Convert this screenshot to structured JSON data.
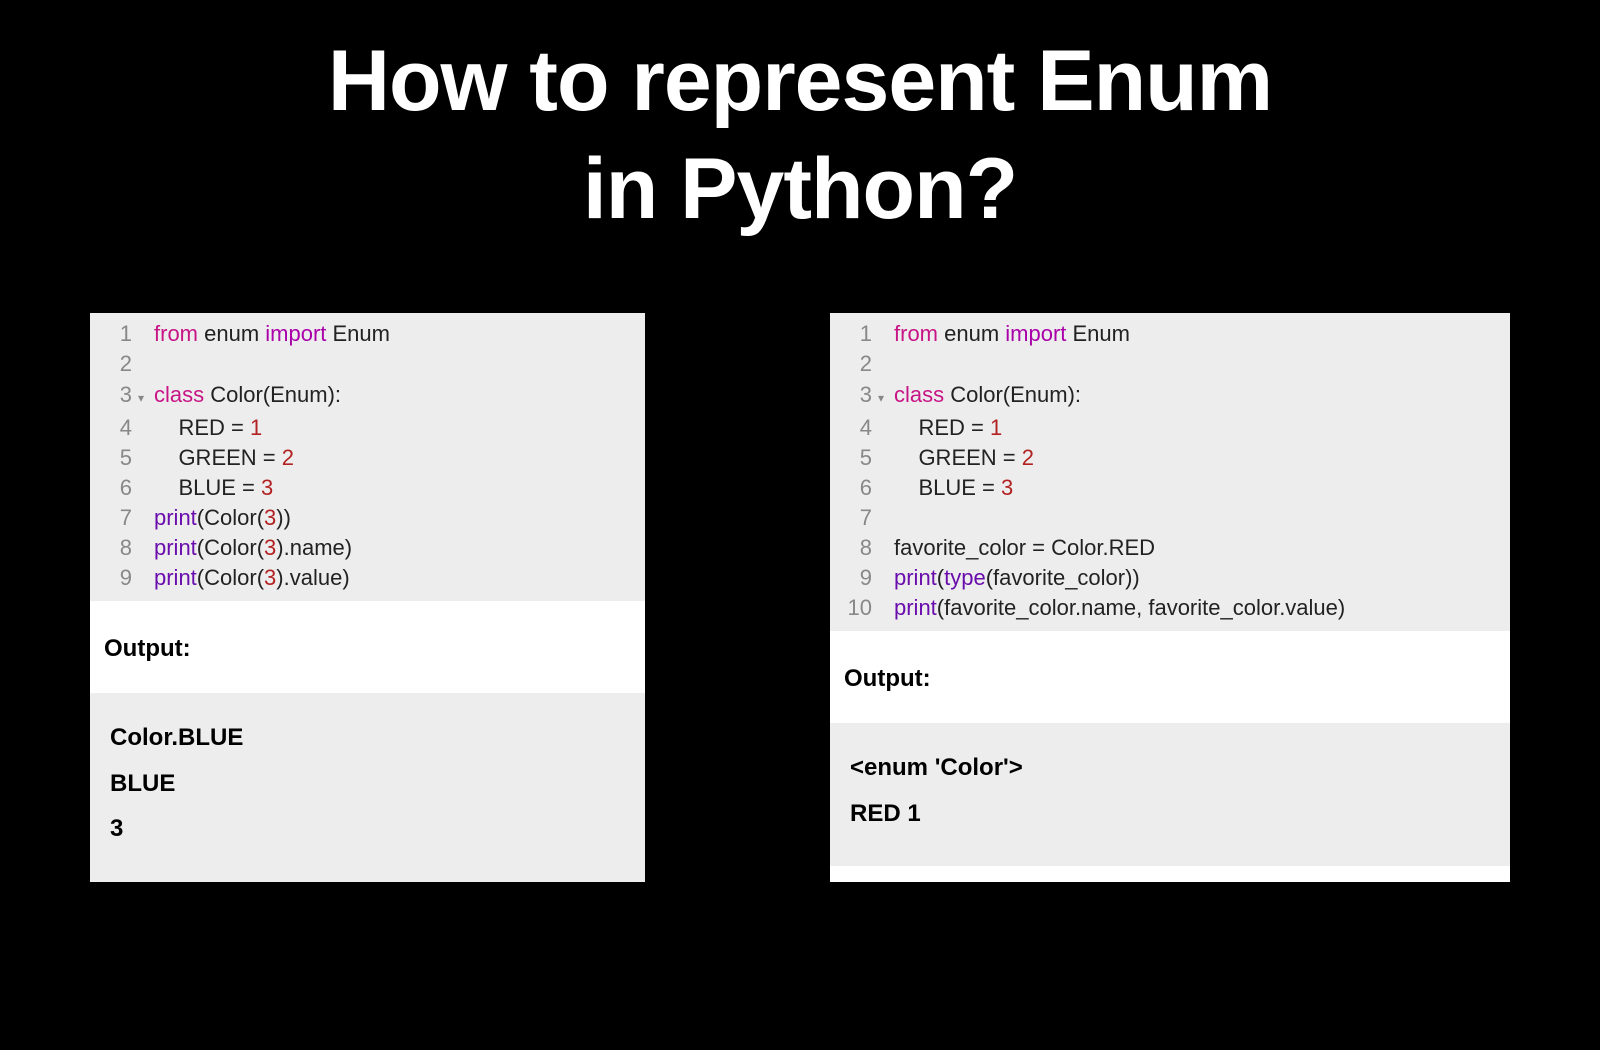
{
  "title_line1": "How to represent Enum",
  "title_line2": "in Python?",
  "left": {
    "lines": [
      {
        "n": "1",
        "fold": "",
        "segments": [
          {
            "t": "from",
            "c": "kw"
          },
          {
            "t": " enum ",
            "c": "txt"
          },
          {
            "t": "import",
            "c": "kw2"
          },
          {
            "t": " Enum",
            "c": "txt"
          }
        ]
      },
      {
        "n": "2",
        "fold": "",
        "segments": []
      },
      {
        "n": "3",
        "fold": "▾",
        "segments": [
          {
            "t": "class",
            "c": "kw"
          },
          {
            "t": " Color(Enum):",
            "c": "txt"
          }
        ]
      },
      {
        "n": "4",
        "fold": "",
        "segments": [
          {
            "t": "    RED = ",
            "c": "txt"
          },
          {
            "t": "1",
            "c": "num"
          }
        ]
      },
      {
        "n": "5",
        "fold": "",
        "segments": [
          {
            "t": "    GREEN = ",
            "c": "txt"
          },
          {
            "t": "2",
            "c": "num"
          }
        ]
      },
      {
        "n": "6",
        "fold": "",
        "segments": [
          {
            "t": "    BLUE = ",
            "c": "txt"
          },
          {
            "t": "3",
            "c": "num"
          }
        ]
      },
      {
        "n": "7",
        "fold": "",
        "segments": [
          {
            "t": "print",
            "c": "fn"
          },
          {
            "t": "(Color(",
            "c": "txt"
          },
          {
            "t": "3",
            "c": "num"
          },
          {
            "t": "))",
            "c": "txt"
          }
        ]
      },
      {
        "n": "8",
        "fold": "",
        "segments": [
          {
            "t": "print",
            "c": "fn"
          },
          {
            "t": "(Color(",
            "c": "txt"
          },
          {
            "t": "3",
            "c": "num"
          },
          {
            "t": ").name)",
            "c": "txt"
          }
        ]
      },
      {
        "n": "9",
        "fold": "",
        "segments": [
          {
            "t": "print",
            "c": "fn"
          },
          {
            "t": "(Color(",
            "c": "txt"
          },
          {
            "t": "3",
            "c": "num"
          },
          {
            "t": ").value)",
            "c": "txt"
          }
        ]
      }
    ],
    "output_label": "Output:",
    "output": [
      "Color.BLUE",
      "BLUE",
      "3"
    ]
  },
  "right": {
    "lines": [
      {
        "n": "1",
        "fold": "",
        "segments": [
          {
            "t": "from",
            "c": "kw"
          },
          {
            "t": " enum ",
            "c": "txt"
          },
          {
            "t": "import",
            "c": "kw2"
          },
          {
            "t": " Enum",
            "c": "txt"
          }
        ]
      },
      {
        "n": "2",
        "fold": "",
        "segments": []
      },
      {
        "n": "3",
        "fold": "▾",
        "segments": [
          {
            "t": "class",
            "c": "kw"
          },
          {
            "t": " Color(Enum):",
            "c": "txt"
          }
        ]
      },
      {
        "n": "4",
        "fold": "",
        "segments": [
          {
            "t": "    RED = ",
            "c": "txt"
          },
          {
            "t": "1",
            "c": "num"
          }
        ]
      },
      {
        "n": "5",
        "fold": "",
        "segments": [
          {
            "t": "    GREEN = ",
            "c": "txt"
          },
          {
            "t": "2",
            "c": "num"
          }
        ]
      },
      {
        "n": "6",
        "fold": "",
        "segments": [
          {
            "t": "    BLUE = ",
            "c": "txt"
          },
          {
            "t": "3",
            "c": "num"
          }
        ]
      },
      {
        "n": "7",
        "fold": "",
        "segments": []
      },
      {
        "n": "8",
        "fold": "",
        "segments": [
          {
            "t": "favorite_color = Color.RED",
            "c": "txt"
          }
        ]
      },
      {
        "n": "9",
        "fold": "",
        "segments": [
          {
            "t": "print",
            "c": "fn"
          },
          {
            "t": "(",
            "c": "txt"
          },
          {
            "t": "type",
            "c": "fn"
          },
          {
            "t": "(favorite_color))",
            "c": "txt"
          }
        ]
      },
      {
        "n": "10",
        "fold": "",
        "segments": [
          {
            "t": "print",
            "c": "fn"
          },
          {
            "t": "(favorite_color.name, favorite_color.value)",
            "c": "txt"
          }
        ]
      }
    ],
    "output_label": "Output:",
    "output": [
      "<enum 'Color'>",
      "RED 1"
    ]
  }
}
